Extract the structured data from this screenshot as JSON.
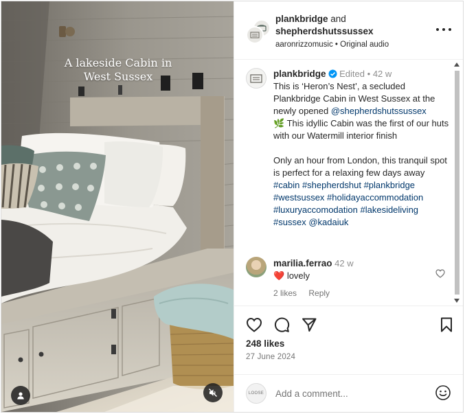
{
  "media": {
    "overlay_text": "A lakeside Cabin in West Sussex"
  },
  "header": {
    "account_1": "plankbridge",
    "joiner": "and",
    "account_2": "shepherdshutssussex",
    "audio": "aaronrizzomusic • Original audio"
  },
  "caption": {
    "username": "plankbridge",
    "edited": "Edited",
    "separator": "•",
    "age": "42 w",
    "text_1": "This is ‘Heron’s Nest’, a secluded Plankbridge Cabin in West Sussex at the newly opened",
    "mention_1": "@shepherdshutssussex",
    "emoji": "🌿",
    "text_2": "This idyllic Cabin was the first of our huts with our Watermill interior finish",
    "text_3": "Only an hour from London, this tranquil spot is perfect for a relaxing few days away",
    "hashtags": [
      "#cabin",
      "#shepherdshut",
      "#plankbridge",
      "#westsussex",
      "#holidayaccommodation",
      "#luxuryaccomodation",
      "#lakesideliving",
      "#sussex"
    ],
    "mention_2": "@kadaiuk"
  },
  "comment": {
    "username": "marilia.ferrao",
    "age": "42 w",
    "heart_emoji": "❤️",
    "text": "lovely",
    "likes": "2 likes",
    "reply_label": "Reply"
  },
  "footer": {
    "likes": "248 likes",
    "date": "27 June 2024",
    "add_comment_placeholder": "Add a comment...",
    "viewer_avatar_text": "LOOSE"
  },
  "icons": {
    "like": "heart-icon",
    "comment": "comment-icon",
    "share": "send-icon",
    "save": "bookmark-icon",
    "more": "more-icon",
    "emoji": "emoji-icon",
    "mute": "muted-icon",
    "tagged": "user-icon"
  },
  "colors": {
    "link": "#00376b",
    "verified": "#0095f6",
    "text": "#262626",
    "secondary": "#737373",
    "comment_heart": "#ed4956"
  }
}
